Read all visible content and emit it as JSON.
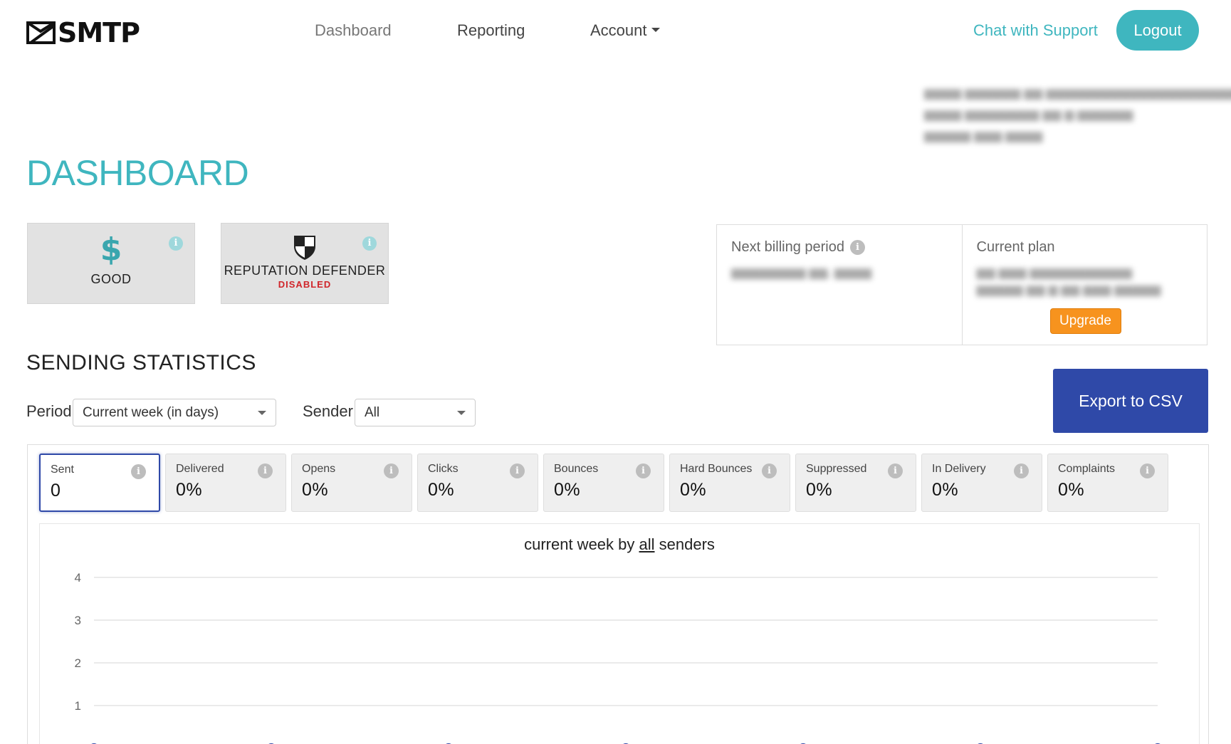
{
  "header": {
    "logo_text": "SMTP",
    "nav": [
      "Dashboard",
      "Reporting",
      "Account"
    ],
    "support_link": "Chat with Support",
    "logout_label": "Logout"
  },
  "page_title": "DASHBOARD",
  "status_tiles": {
    "good_symbol": "$",
    "good_label": "GOOD",
    "reputation_label": "REPUTATION DEFENDER",
    "reputation_status": "DISABLED",
    "info_glyph": "i"
  },
  "billing": {
    "next_billing_label": "Next billing period",
    "current_plan_label": "Current plan",
    "upgrade_label": "Upgrade"
  },
  "sending_statistics": {
    "title": "SENDING STATISTICS",
    "export_label": "Export to CSV",
    "period_label": "Period",
    "period_value": "Current week (in days)",
    "sender_label": "Sender",
    "sender_value": "All"
  },
  "metrics": [
    {
      "label": "Sent",
      "value": "0"
    },
    {
      "label": "Delivered",
      "value": "0%"
    },
    {
      "label": "Opens",
      "value": "0%"
    },
    {
      "label": "Clicks",
      "value": "0%"
    },
    {
      "label": "Bounces",
      "value": "0%"
    },
    {
      "label": "Hard Bounces",
      "value": "0%"
    },
    {
      "label": "Suppressed",
      "value": "0%"
    },
    {
      "label": "In Delivery",
      "value": "0%"
    },
    {
      "label": "Complaints",
      "value": "0%"
    }
  ],
  "chart_title": {
    "prefix": "current week by ",
    "link": "all",
    "suffix": " senders"
  },
  "chart_data": {
    "type": "line",
    "y_ticks": [
      1,
      2,
      3,
      4
    ],
    "ylim": [
      0,
      4
    ],
    "series": [
      {
        "values": [
          0,
          0,
          0,
          0,
          0,
          0,
          0
        ]
      }
    ],
    "grid": true,
    "line_color": "#2f49a8"
  }
}
